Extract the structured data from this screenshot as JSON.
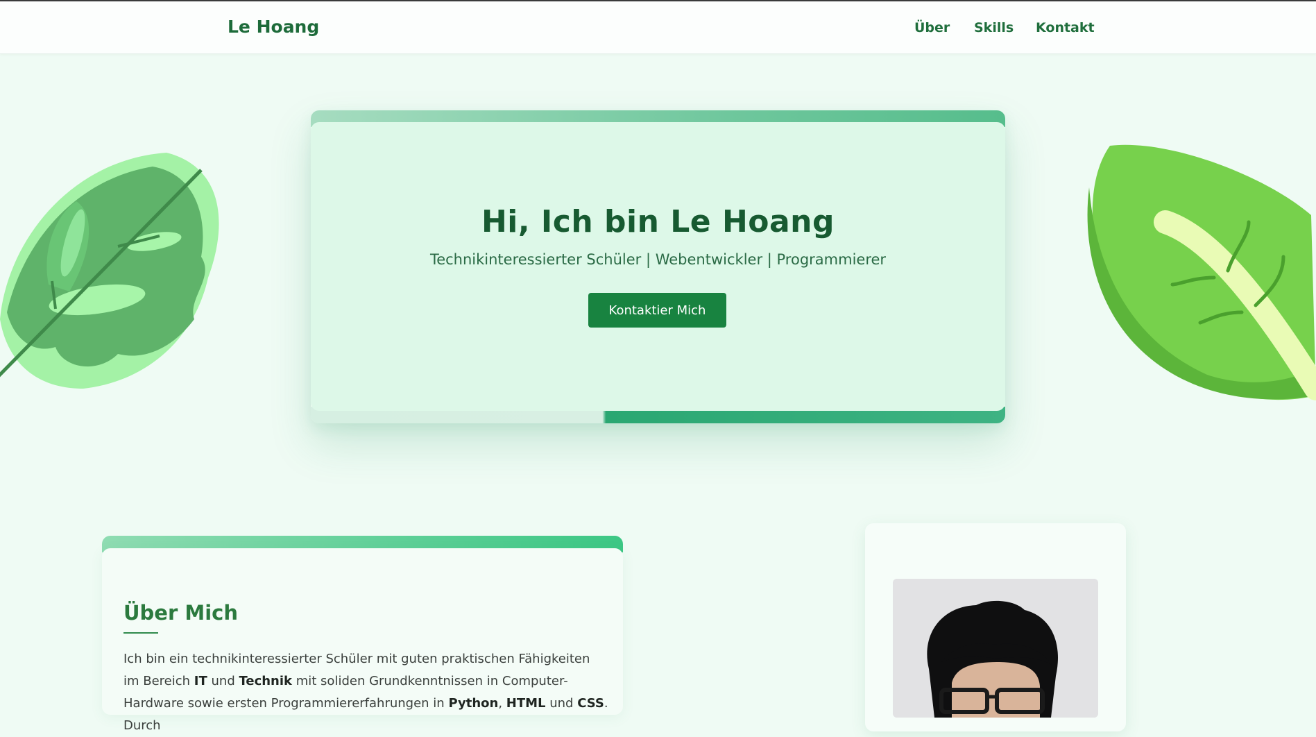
{
  "nav": {
    "brand": "Le Hoang",
    "links": [
      "Über",
      "Skills",
      "Kontakt"
    ]
  },
  "hero": {
    "title": "Hi, Ich bin Le Hoang",
    "subtitle": "Technikinteressierter Schüler | Webentwickler | Programmierer",
    "button": "Kontaktier Mich"
  },
  "about": {
    "title": "Über Mich",
    "text_parts": [
      "Ich bin ein technikinteressierter Schüler mit guten praktischen Fähigkeiten im Bereich ",
      "IT",
      " und ",
      "Technik",
      " mit soliden Grundkenntnissen in Computer-Hardware sowie ersten Programmiererfahrungen in ",
      "Python",
      ", ",
      "HTML",
      " und ",
      "CSS",
      ". Durch"
    ]
  },
  "colors": {
    "brand_green": "#1d6b3a",
    "button_green": "#188340",
    "page_bg": "#effbf4",
    "hero_card_bg": "#ddf8e8"
  },
  "icons": {
    "leaf_left": "leaf-illustration-left",
    "leaf_right": "leaf-illustration-right",
    "profile_photo": "profile-photo"
  }
}
